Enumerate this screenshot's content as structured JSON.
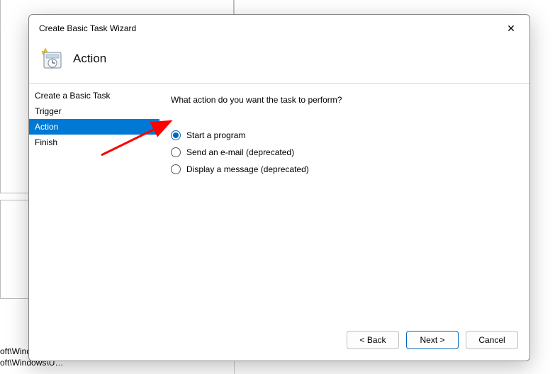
{
  "dialog": {
    "title": "Create Basic Task Wizard",
    "page_heading": "Action",
    "close_glyph": "✕"
  },
  "steps": {
    "items": [
      {
        "label": "Create a Basic Task",
        "active": false
      },
      {
        "label": "Trigger",
        "active": false
      },
      {
        "label": "Action",
        "active": true
      },
      {
        "label": "Finish",
        "active": false
      }
    ]
  },
  "content": {
    "prompt": "What action do you want the task to perform?",
    "options": [
      {
        "label": "Start a program",
        "selected": true
      },
      {
        "label": "Send an e-mail (deprecated)",
        "selected": false
      },
      {
        "label": "Display a message (deprecated)",
        "selected": false
      }
    ]
  },
  "buttons": {
    "back": "< Back",
    "next": "Next >",
    "cancel": "Cancel"
  },
  "annotation": {
    "arrow_color": "#ff0000"
  },
  "background": {
    "truncated_paths": "oft\\Windo…\noft\\Windows\\U…"
  }
}
